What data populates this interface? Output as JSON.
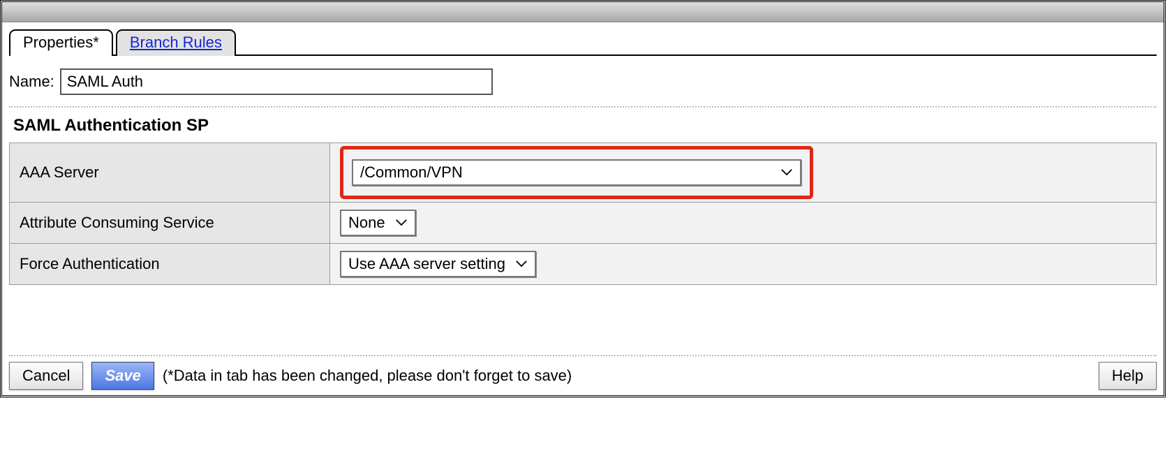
{
  "tabs": {
    "properties": "Properties*",
    "branch_rules": "Branch Rules"
  },
  "name_label": "Name:",
  "name_value": "SAML Auth",
  "section_title": "SAML Authentication SP",
  "rows": {
    "aaa_server": {
      "label": "AAA Server",
      "value": "/Common/VPN"
    },
    "attr_consuming": {
      "label": "Attribute Consuming Service",
      "value": "None"
    },
    "force_auth": {
      "label": "Force Authentication",
      "value": "Use AAA server setting"
    }
  },
  "footer": {
    "cancel": "Cancel",
    "save": "Save",
    "hint": "(*Data in tab has been changed, please don't forget to save)",
    "help": "Help"
  }
}
